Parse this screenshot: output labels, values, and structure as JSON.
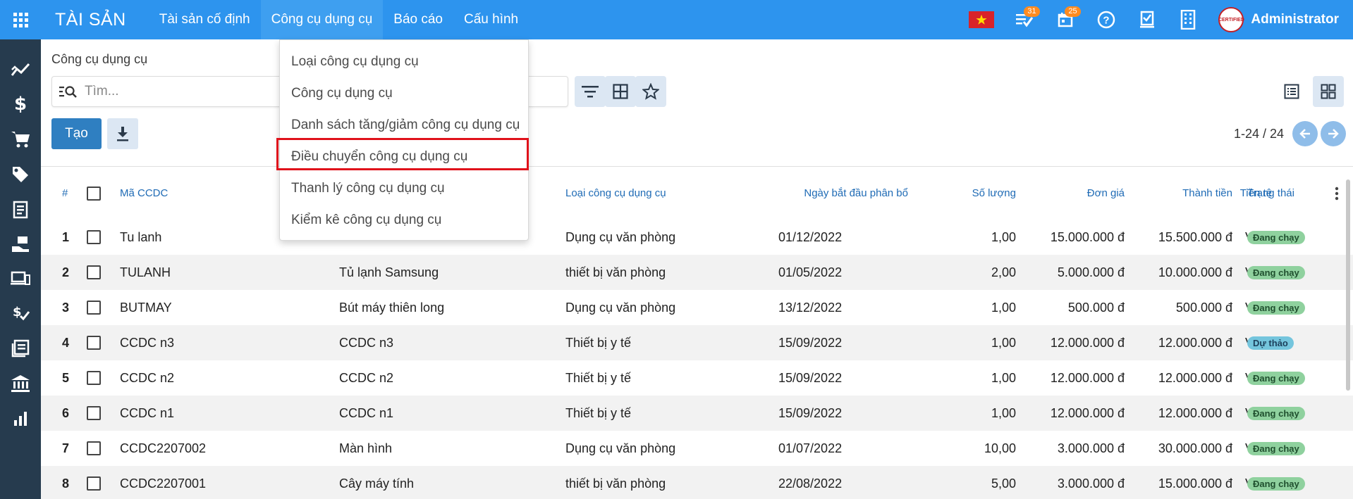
{
  "app": {
    "title": "TÀI SẢN"
  },
  "nav": {
    "items": [
      "Tài sản cố định",
      "Công cụ dụng cụ",
      "Báo cáo",
      "Cấu hình"
    ],
    "active_index": 1
  },
  "topbar": {
    "activities_count": "31",
    "calendar_count": "25",
    "user": "Administrator",
    "avatar_text": "CERTIFIED"
  },
  "dropdown": {
    "items": [
      "Loại công cụ dụng cụ",
      "Công cụ dụng cụ",
      "Danh sách tăng/giảm công cụ dụng cụ",
      "Điều chuyển công cụ dụng cụ",
      "Thanh lý công cụ dụng cụ",
      "Kiểm kê công cụ dụng cụ"
    ],
    "highlighted_index": 3
  },
  "control": {
    "breadcrumb": "Công cụ dụng cụ",
    "search_placeholder": "Tìm...",
    "create_label": "Tạo",
    "pager": "1-24 / 24"
  },
  "table": {
    "headers": {
      "num": "#",
      "code": "Mã CCDC",
      "type": "Loại công cụ dụng cụ",
      "start_date": "Ngày bắt đầu phân bổ",
      "qty": "Số lượng",
      "price": "Đơn giá",
      "total": "Thành tiền",
      "currency": "Tiền tệ",
      "status": "Trạng thái"
    },
    "rows": [
      {
        "num": "1",
        "code": "Tu lanh",
        "name": "",
        "type": "Dụng cụ văn phòng",
        "date": "01/12/2022",
        "qty": "1,00",
        "price": "15.000.000 đ",
        "total": "15.500.000 đ",
        "currency": "VND",
        "status": "Đang chạy",
        "status_kind": "running"
      },
      {
        "num": "2",
        "code": "TULANH",
        "name": "Tủ lạnh Samsung",
        "type": "thiết bị văn phòng",
        "date": "01/05/2022",
        "qty": "2,00",
        "price": "5.000.000 đ",
        "total": "10.000.000 đ",
        "currency": "VND",
        "status": "Đang chạy",
        "status_kind": "running"
      },
      {
        "num": "3",
        "code": "BUTMAY",
        "name": "Bút máy thiên long",
        "type": "Dụng cụ văn phòng",
        "date": "13/12/2022",
        "qty": "1,00",
        "price": "500.000 đ",
        "total": "500.000 đ",
        "currency": "VND",
        "status": "Đang chạy",
        "status_kind": "running"
      },
      {
        "num": "4",
        "code": "CCDC n3",
        "name": "CCDC n3",
        "type": "Thiết bị y tế",
        "date": "15/09/2022",
        "qty": "1,00",
        "price": "12.000.000 đ",
        "total": "12.000.000 đ",
        "currency": "VND",
        "status": "Dự thảo",
        "status_kind": "draft"
      },
      {
        "num": "5",
        "code": "CCDC n2",
        "name": "CCDC n2",
        "type": "Thiết bị y tế",
        "date": "15/09/2022",
        "qty": "1,00",
        "price": "12.000.000 đ",
        "total": "12.000.000 đ",
        "currency": "VND",
        "status": "Đang chạy",
        "status_kind": "running"
      },
      {
        "num": "6",
        "code": "CCDC n1",
        "name": "CCDC n1",
        "type": "Thiết bị y tế",
        "date": "15/09/2022",
        "qty": "1,00",
        "price": "12.000.000 đ",
        "total": "12.000.000 đ",
        "currency": "VND",
        "status": "Đang chạy",
        "status_kind": "running"
      },
      {
        "num": "7",
        "code": "CCDC2207002",
        "name": "Màn hình",
        "type": "Dụng cụ văn phòng",
        "date": "01/07/2022",
        "qty": "10,00",
        "price": "3.000.000 đ",
        "total": "30.000.000 đ",
        "currency": "VND",
        "status": "Đang chạy",
        "status_kind": "running"
      },
      {
        "num": "8",
        "code": "CCDC2207001",
        "name": "Cây máy tính",
        "type": "thiết bị văn phòng",
        "date": "22/08/2022",
        "qty": "5,00",
        "price": "3.000.000 đ",
        "total": "15.000.000 đ",
        "currency": "VND",
        "status": "Đang chạy",
        "status_kind": "running"
      }
    ]
  },
  "sidebar": {
    "icons": [
      "trend-icon",
      "dollar-icon",
      "cart-icon",
      "tag-icon",
      "receipt-icon",
      "hand-coins-icon",
      "devices-icon",
      "money-check-icon",
      "ledger-icon",
      "bank-icon",
      "bar-chart-icon"
    ]
  },
  "colors": {
    "topbar": "#2d94ee",
    "sidebar": "#263b4e",
    "primary_button": "#2f7fc1",
    "status_running": "#8fd19e",
    "status_draft": "#74c5dd",
    "highlight": "#e0121b"
  }
}
